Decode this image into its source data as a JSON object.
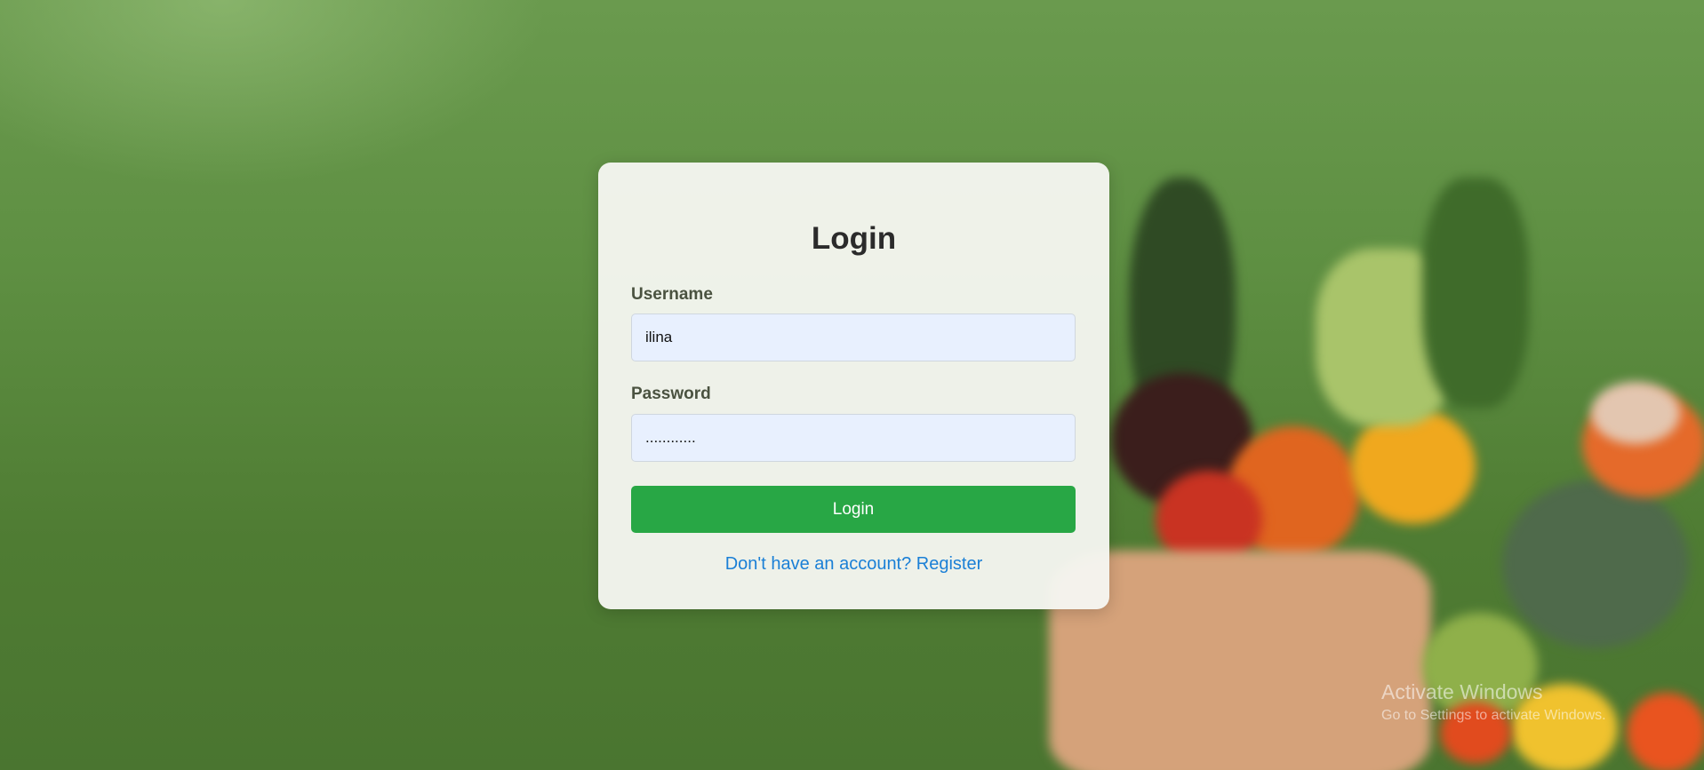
{
  "login": {
    "title": "Login",
    "username_label": "Username",
    "username_value": "ilina",
    "password_label": "Password",
    "password_value": "............",
    "submit_label": "Login",
    "register_link": "Don't have an account? Register"
  },
  "watermark": {
    "title": "Activate Windows",
    "subtitle": "Go to Settings to activate Windows."
  },
  "colors": {
    "accent": "#28a745",
    "link": "#1a7fd6",
    "input_bg": "#e8f0fe"
  }
}
